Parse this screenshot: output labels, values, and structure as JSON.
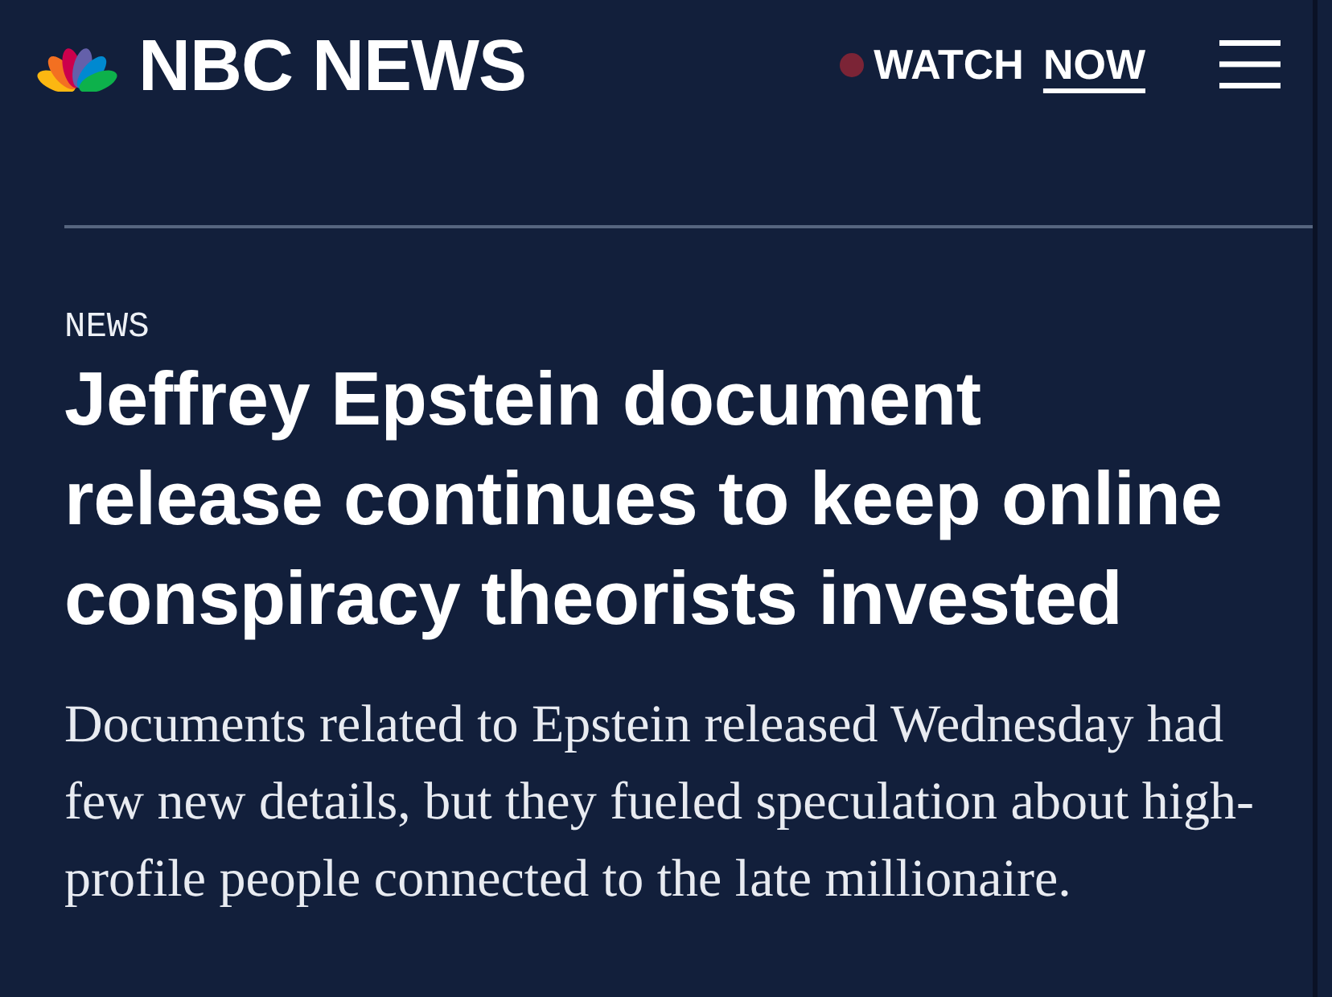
{
  "header": {
    "logo": "NBC NEWS",
    "watch_link": {
      "label": "WATCH",
      "underlined": "NOW"
    }
  },
  "article": {
    "section": "NEWS",
    "headline": "Jeffrey Epstein document release continues to keep online conspiracy theorists invested",
    "summary": "Documents related to Epstein released Wednesday had few new details, but they fueled speculation about high-profile people connected to the late millionaire."
  }
}
